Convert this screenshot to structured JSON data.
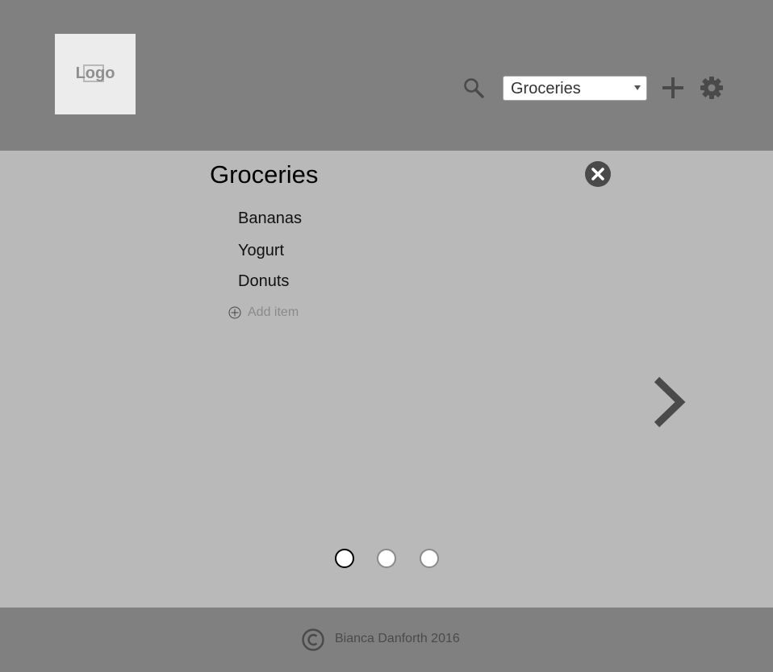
{
  "header": {
    "logo_text": "Logo",
    "search_icon": "search-icon",
    "list_select": {
      "value": "Groceries"
    },
    "add_icon": "plus-icon",
    "settings_icon": "gear-icon"
  },
  "main": {
    "title": "Groceries",
    "close_icon": "close-circle-icon",
    "items": [
      {
        "label": "Bananas"
      },
      {
        "label": "Yogurt"
      },
      {
        "label": "Donuts"
      }
    ],
    "add_item_label": "Add item",
    "next_icon": "chevron-right-icon",
    "pagination": {
      "total": 3,
      "active": 1
    }
  },
  "footer": {
    "text": "Bianca Danforth 2016"
  },
  "colors": {
    "header_bg": "#808080",
    "main_bg": "#b9b9b9",
    "footer_bg": "#808080",
    "icon": "#4a4a4a"
  }
}
